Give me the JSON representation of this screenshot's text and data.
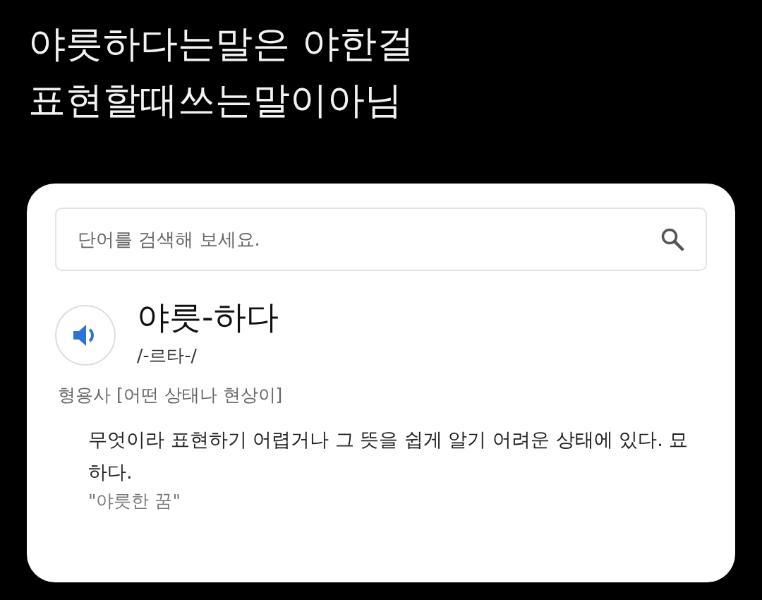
{
  "caption": [
    "야릇하다는말은 야한걸",
    "표현할때쓰는말이아님"
  ],
  "search": {
    "placeholder": "단어를 검색해 보세요."
  },
  "entry": {
    "headword": "야릇-하다",
    "pronunciation": "/-르타-/",
    "part_of_speech": "형용사 [어떤 상태나 현상이]",
    "definition": "무엇이라 표현하기 어렵거나 그 뜻을 쉽게 알기 어려운 상태에 있다. 묘하다.",
    "example": "\"야릇한 꿈\""
  }
}
